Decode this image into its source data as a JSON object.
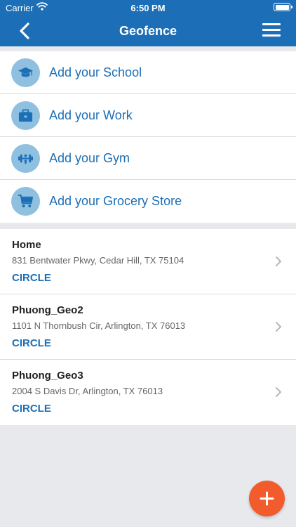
{
  "status_bar": {
    "carrier": "Carrier",
    "time": "6:50 PM"
  },
  "nav": {
    "title": "Geofence",
    "back_icon": "chevron-left-icon",
    "menu_icon": "hamburger-menu-icon"
  },
  "colors": {
    "brand": "#1c6fb6",
    "icon_bg": "#8fc0df",
    "fab": "#f25b2b",
    "background": "#e7e9ec"
  },
  "quick_add": [
    {
      "label": "Add your School",
      "icon": "graduation-cap-icon"
    },
    {
      "label": "Add your Work",
      "icon": "briefcase-icon"
    },
    {
      "label": "Add your Gym",
      "icon": "dumbbell-icon"
    },
    {
      "label": "Add your Grocery Store",
      "icon": "shopping-cart-icon"
    }
  ],
  "geofences": [
    {
      "name": "Home",
      "address": "831 Bentwater Pkwy, Cedar Hill, TX 75104",
      "type": "CIRCLE"
    },
    {
      "name": "Phuong_Geo2",
      "address": "1101 N Thornbush Cir, Arlington, TX 76013",
      "type": "CIRCLE"
    },
    {
      "name": "Phuong_Geo3",
      "address": "2004 S Davis Dr, Arlington, TX 76013",
      "type": "CIRCLE"
    }
  ],
  "fab": {
    "icon": "plus-icon"
  }
}
